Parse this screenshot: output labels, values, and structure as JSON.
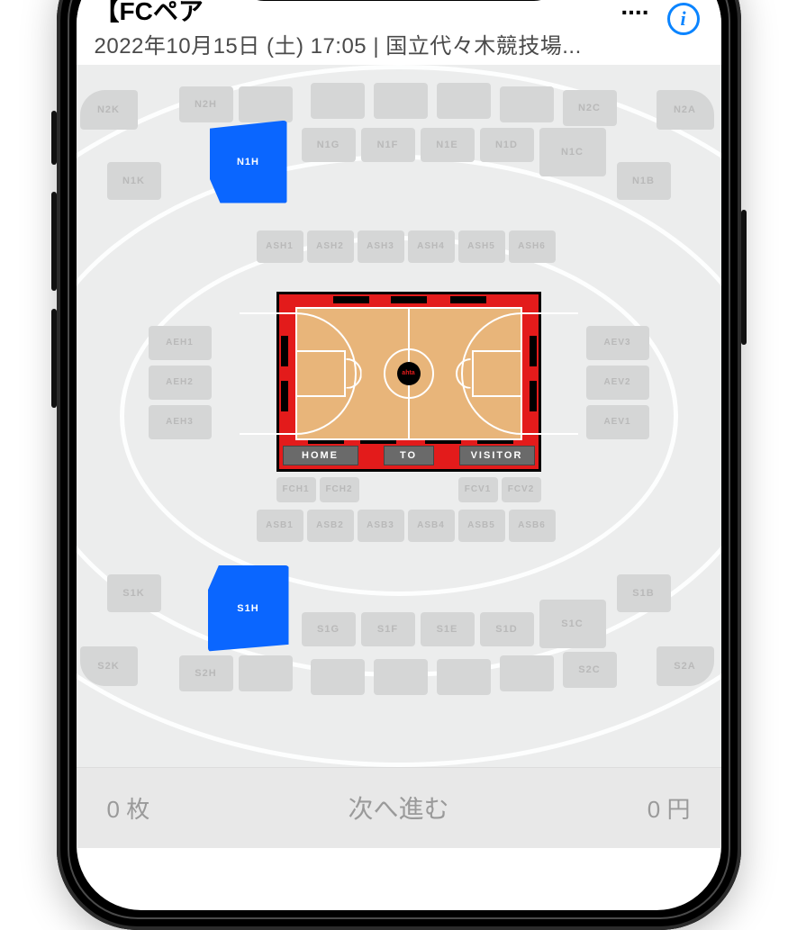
{
  "header": {
    "title": "【FCペア",
    "title_suffix": "....",
    "subtitle": "2022年10月15日 (土) 17:05 | 国立代々木競技場..."
  },
  "available_sections": [
    "N1H",
    "S1H"
  ],
  "court": {
    "home_label": "HOME",
    "to_label": "TO",
    "visitor_label": "VISITOR",
    "center_text": "ahta"
  },
  "footer": {
    "qty_value": 0,
    "qty_suffix": "枚",
    "next_label": "次へ進む",
    "price_value": 0,
    "price_suffix": "円"
  },
  "sections": {
    "N2K": "N2K",
    "N2H": "N2H",
    "N1H": "N1H",
    "N1G": "N1G",
    "N1F": "N1F",
    "N1E": "N1E",
    "N1D": "N1D",
    "N2C": "N2C",
    "N2A": "N2A",
    "N1K": "N1K",
    "N1C": "N1C",
    "N1B": "N1B",
    "ASH1": "ASH1",
    "ASH2": "ASH2",
    "ASH3": "ASH3",
    "ASH4": "ASH4",
    "ASH5": "ASH5",
    "ASH6": "ASH6",
    "AEH1": "AEH1",
    "AEH2": "AEH2",
    "AEH3": "AEH3",
    "AEV1": "AEV1",
    "AEV2": "AEV2",
    "AEV3": "AEV3",
    "FCH1": "FCH1",
    "FCH2": "FCH2",
    "FCV1": "FCV1",
    "FCV2": "FCV2",
    "ASB1": "ASB1",
    "ASB2": "ASB2",
    "ASB3": "ASB3",
    "ASB4": "ASB4",
    "ASB5": "ASB5",
    "ASB6": "ASB6",
    "S1K": "S1K",
    "S1H": "S1H",
    "S1G": "S1G",
    "S1F": "S1F",
    "S1E": "S1E",
    "S1D": "S1D",
    "S1C": "S1C",
    "S1B": "S1B",
    "S2K": "S2K",
    "S2H": "S2H",
    "S2C": "S2C",
    "S2A": "S2A"
  }
}
